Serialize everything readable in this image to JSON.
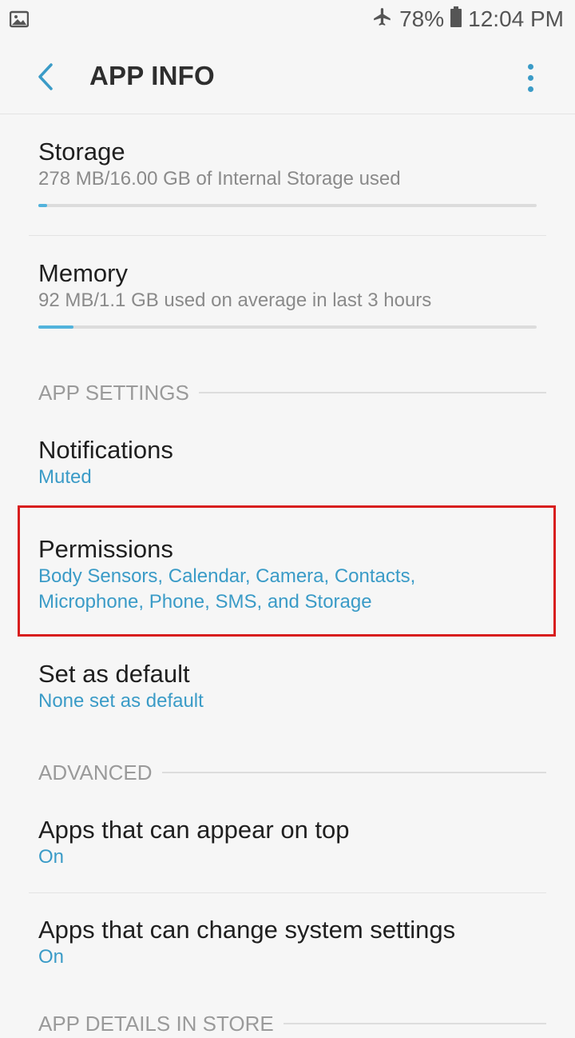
{
  "status_bar": {
    "battery": "78%",
    "time": "12:04 PM"
  },
  "app_bar": {
    "title": "APP INFO"
  },
  "storage": {
    "title": "Storage",
    "subtitle": "278 MB/16.00 GB of Internal Storage used",
    "progress_fraction": 0.017
  },
  "memory": {
    "title": "Memory",
    "subtitle": "92 MB/1.1 GB used on average in last 3 hours",
    "progress_fraction": 0.07
  },
  "sections": {
    "app_settings": "APP SETTINGS",
    "advanced": "ADVANCED",
    "app_details": "APP DETAILS IN STORE"
  },
  "notifications": {
    "title": "Notifications",
    "subtitle": "Muted"
  },
  "permissions": {
    "title": "Permissions",
    "subtitle_line1": "Body Sensors, Calendar, Camera, Contacts,",
    "subtitle_line2": "Microphone, Phone, SMS, and Storage"
  },
  "default": {
    "title": "Set as default",
    "subtitle": "None set as default"
  },
  "appear_on_top": {
    "title": "Apps that can appear on top",
    "subtitle": "On"
  },
  "change_settings": {
    "title": "Apps that can change system settings",
    "subtitle": "On"
  },
  "colors": {
    "accent": "#3a9bc7",
    "progress": "#52b3dc",
    "highlight": "#d81e1e"
  }
}
